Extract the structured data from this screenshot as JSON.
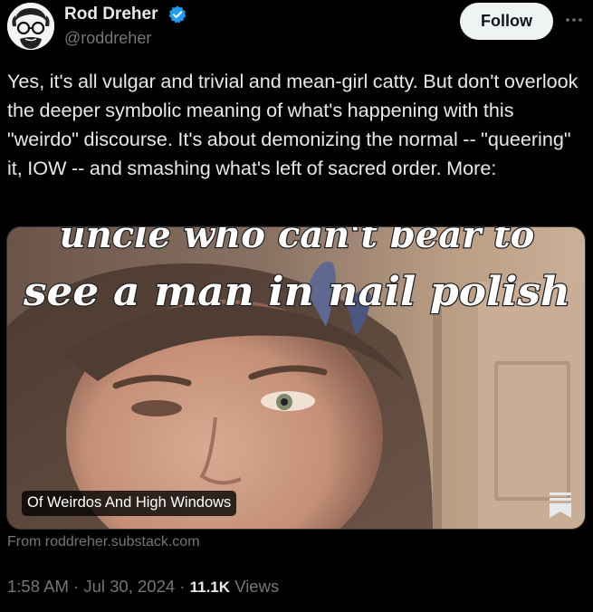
{
  "author": {
    "name": "Rod Dreher",
    "handle": "@roddreher",
    "verified_icon": "verified-badge-icon",
    "avatar_icon": "avatar-illustration"
  },
  "actions": {
    "follow_label": "Follow",
    "more_icon": "more-options-icon"
  },
  "tweet": {
    "text": "Yes, it's all vulgar and trivial and mean-girl catty. But don't overlook the deeper symbolic meaning of what's happening with this \"weirdo\" discourse. It's about demonizing the normal -- \"queering\" it, IOW -- and smashing what's left of sacred order. More:"
  },
  "card": {
    "overlay_line1": "uncle who can't bear to",
    "overlay_line2": "see a man in nail polish",
    "title": "Of Weirdos And High Windows",
    "publisher_icon": "substack-bookmark-icon",
    "source": "From roddreher.substack.com"
  },
  "meta": {
    "time": "1:58 AM",
    "separator": "·",
    "date": "Jul 30, 2024",
    "views_count": "11.1K",
    "views_label": "Views"
  },
  "colors": {
    "background": "#000000",
    "text_primary": "#e7e9ea",
    "text_secondary": "#71767b",
    "verified_blue": "#1d9bf0",
    "follow_bg": "#eff3f4"
  }
}
